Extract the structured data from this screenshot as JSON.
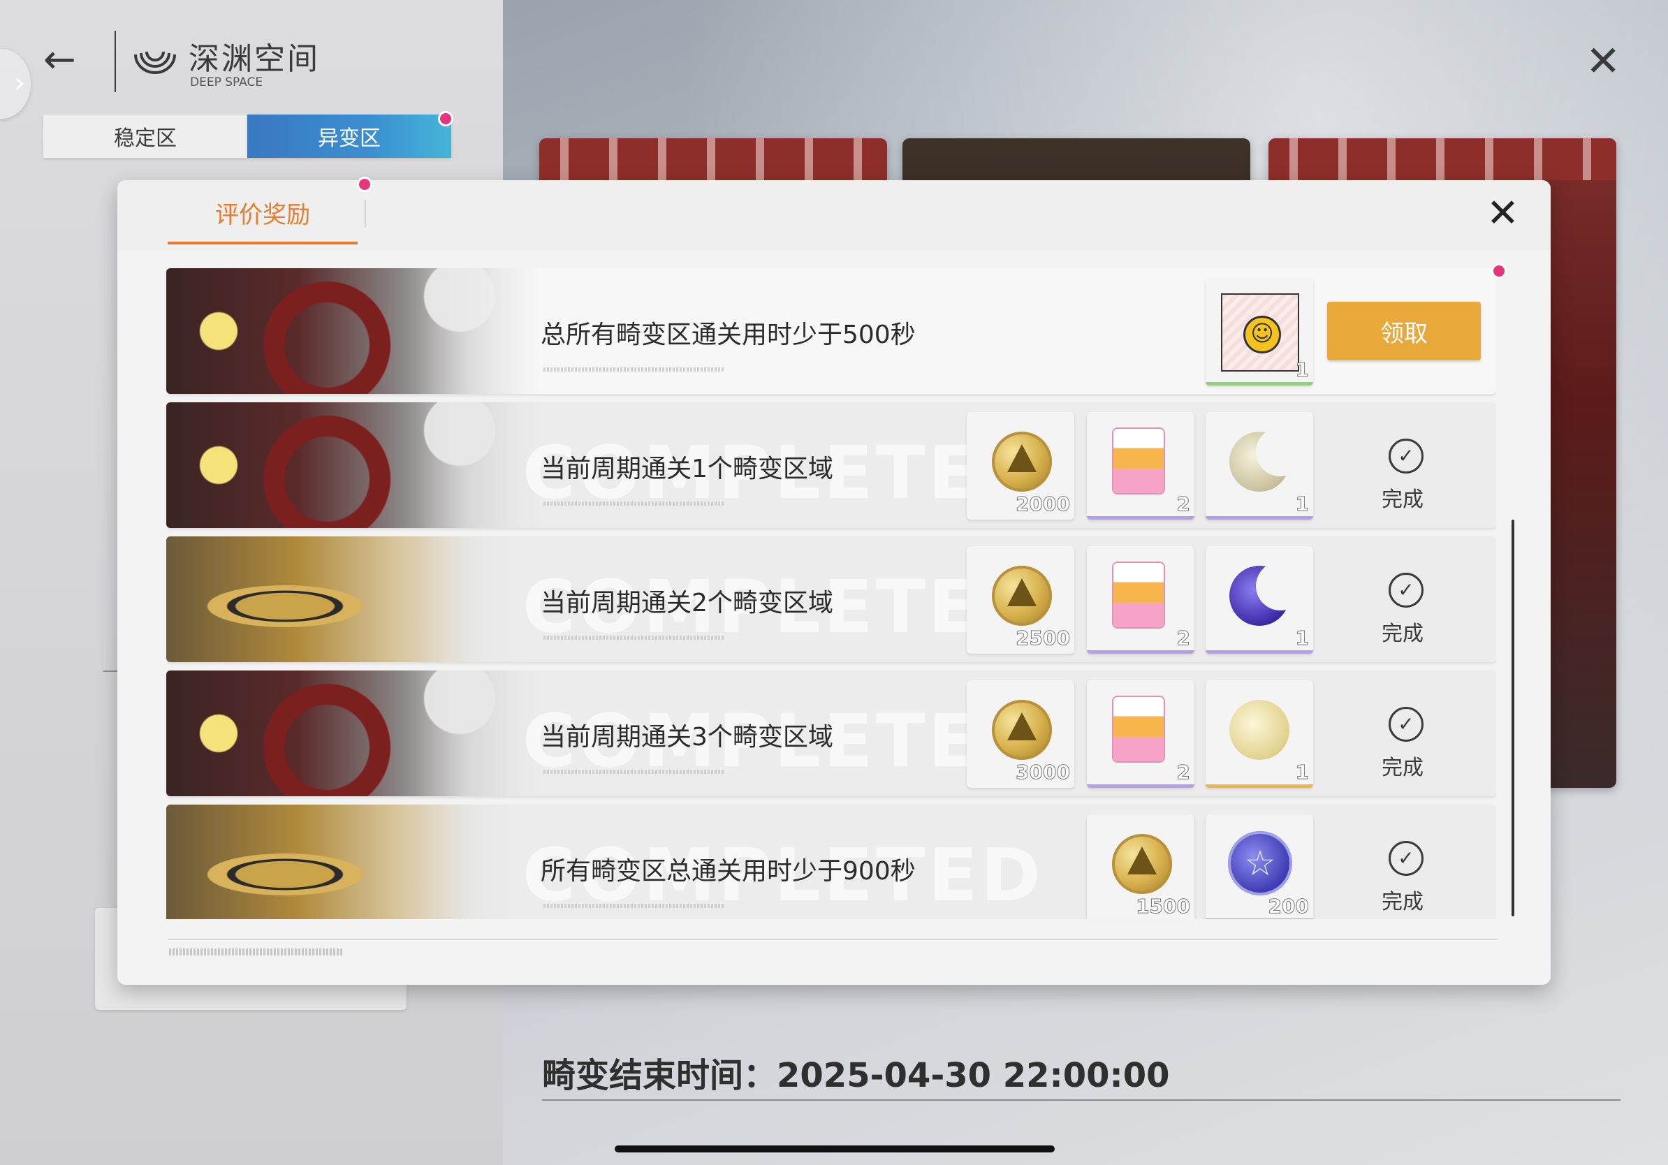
{
  "header": {
    "back_icon": "arrow-left-icon",
    "logo_title": "深渊空间",
    "logo_subtitle": "DEEP SPACE",
    "close_icon": "close-icon"
  },
  "zone_tabs": [
    {
      "label": "稳定区",
      "selected": false
    },
    {
      "label": "异变区",
      "selected": true,
      "badge": true
    }
  ],
  "modal": {
    "tab_label": "评价奖励",
    "close_icon": "close-icon",
    "accent_color": "#ea7b2b",
    "tasks": [
      {
        "title": "总所有畸变区通关用时少于500秒",
        "status": "claimable",
        "action_label": "领取",
        "watermark": "",
        "rewards": [
          {
            "icon": "smile-card-icon",
            "qty": "1",
            "bar_color": "#8fd36b"
          }
        ]
      },
      {
        "title": "当前周期通关1个畸变区域",
        "status": "done",
        "action_label": "完成",
        "watermark": "COMPLETED",
        "rewards": [
          {
            "icon": "gold-coin-icon",
            "qty": "2000",
            "bar_color": ""
          },
          {
            "icon": "milk-carton-icon",
            "qty": "2",
            "bar_color": "#b49cf0"
          },
          {
            "icon": "silver-moon-icon",
            "qty": "1",
            "bar_color": "#b49cf0"
          }
        ]
      },
      {
        "title": "当前周期通关2个畸变区域",
        "status": "done",
        "action_label": "完成",
        "watermark": "COMPLETED",
        "rewards": [
          {
            "icon": "gold-coin-icon",
            "qty": "2500",
            "bar_color": ""
          },
          {
            "icon": "milk-carton-icon",
            "qty": "2",
            "bar_color": "#b49cf0"
          },
          {
            "icon": "purple-moon-icon",
            "qty": "1",
            "bar_color": "#b49cf0"
          }
        ]
      },
      {
        "title": "当前周期通关3个畸变区域",
        "status": "done",
        "action_label": "完成",
        "watermark": "COMPLETED",
        "rewards": [
          {
            "icon": "gold-coin-icon",
            "qty": "3000",
            "bar_color": ""
          },
          {
            "icon": "milk-carton-icon",
            "qty": "2",
            "bar_color": "#b49cf0"
          },
          {
            "icon": "gold-moon-icon",
            "qty": "1",
            "bar_color": "#f2b24a"
          }
        ]
      },
      {
        "title": "所有畸变区总通关用时少于900秒",
        "status": "done",
        "action_label": "完成",
        "watermark": "COMPLETED",
        "rewards": [
          {
            "icon": "gold-coin-icon",
            "qty": "1500",
            "bar_color": ""
          },
          {
            "icon": "star-coin-icon",
            "qty": "200",
            "bar_color": "#b49cf0"
          }
        ]
      }
    ]
  },
  "footer": {
    "end_time_label": "畸变结束时间：2025-04-30 22:00:00"
  },
  "colors": {
    "claim_button": "#e9a83a",
    "anomaly_tab": "#3a8fd0",
    "badge": "#e6357d"
  }
}
